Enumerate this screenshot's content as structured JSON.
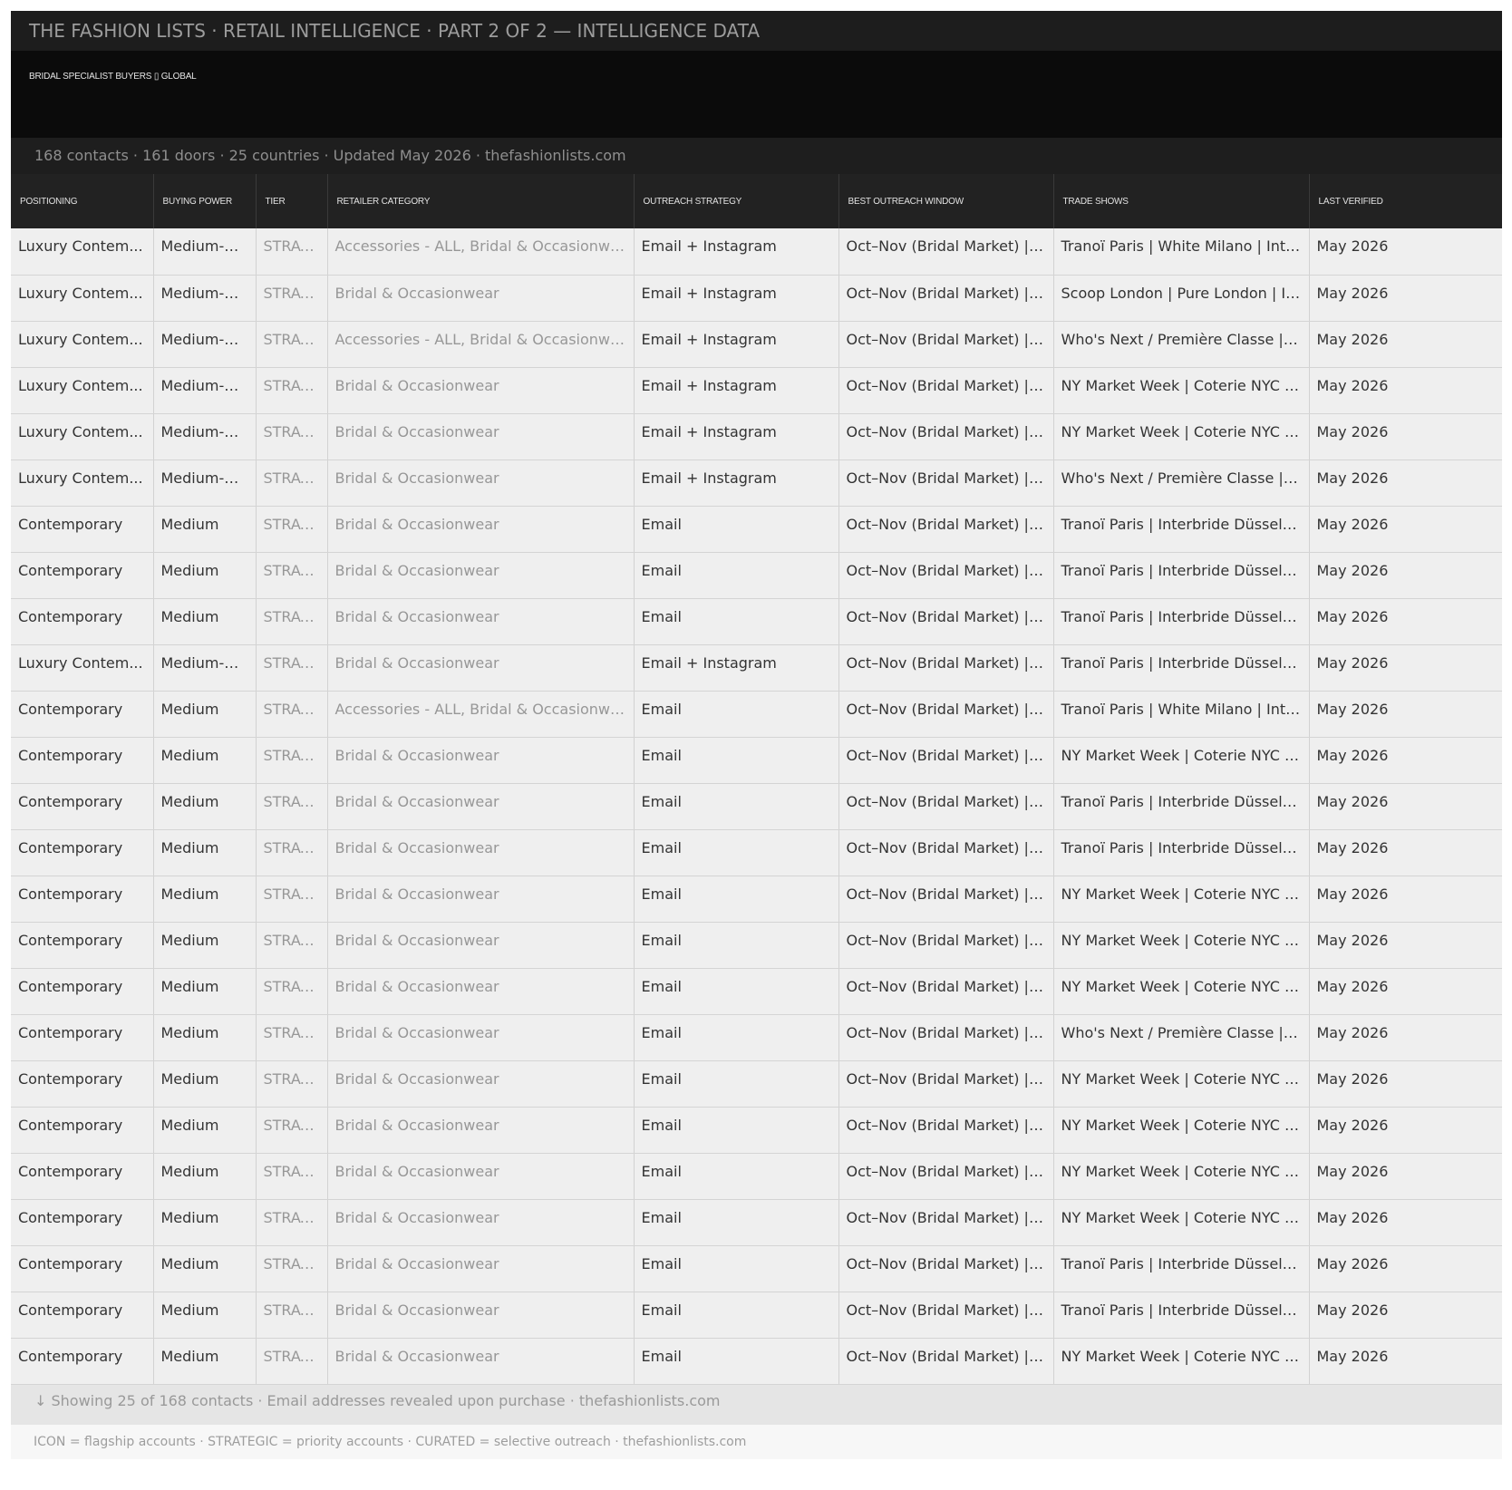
{
  "header": {
    "title": "THE FASHION LISTS  ·  RETAIL INTELLIGENCE  ·  PART 2 OF 2 — INTELLIGENCE DATA",
    "subtitle": "BRIDAL SPECIALIST BUYERS ▯ GLOBAL",
    "stats": "168 contacts  ·  161 doors  ·  25 countries  ·  Updated May 2026  ·  thefashionlists.com"
  },
  "table": {
    "columns": [
      "POSITIONING",
      "BUYING POWER",
      "TIER",
      "RETAILER CATEGORY",
      "OUTREACH STRATEGY",
      "BEST OUTREACH WINDOW",
      "TRADE SHOWS",
      "LAST VERIFIED"
    ],
    "rows": [
      [
        "Luxury Contem...",
        "Medium-Hi...",
        "STRAT...",
        "Accessories - ALL, Bridal & Occasionwear...",
        "Email + Instagram",
        "Oct–Nov (Bridal Market) | A...",
        "Tranoï Paris | White Milano | Inter...",
        "May 2026"
      ],
      [
        "Luxury Contem...",
        "Medium-Hi...",
        "STRAT...",
        "Bridal & Occasionwear",
        "Email + Instagram",
        "Oct–Nov (Bridal Market) | A...",
        "Scoop London | Pure London | Int...",
        "May 2026"
      ],
      [
        "Luxury Contem...",
        "Medium-Hi...",
        "STRAT...",
        "Accessories - ALL, Bridal & Occasionwear...",
        "Email + Instagram",
        "Oct–Nov (Bridal Market) | A...",
        "Who's Next / Première Classe | C...",
        "May 2026"
      ],
      [
        "Luxury Contem...",
        "Medium-Hi...",
        "STRAT...",
        "Bridal & Occasionwear",
        "Email + Instagram",
        "Oct–Nov (Bridal Market) | A...",
        "NY Market Week | Coterie NYC | I...",
        "May 2026"
      ],
      [
        "Luxury Contem...",
        "Medium-Hi...",
        "STRAT...",
        "Bridal & Occasionwear",
        "Email + Instagram",
        "Oct–Nov (Bridal Market) | A...",
        "NY Market Week | Coterie NYC | I...",
        "May 2026"
      ],
      [
        "Luxury Contem...",
        "Medium-Hi...",
        "STRAT...",
        "Bridal & Occasionwear",
        "Email + Instagram",
        "Oct–Nov (Bridal Market) | A...",
        "Who's Next / Première Classe | C...",
        "May 2026"
      ],
      [
        "Contemporary",
        "Medium",
        "STRAT...",
        "Bridal & Occasionwear",
        "Email",
        "Oct–Nov (Bridal Market) | A...",
        "Tranoï Paris | Interbride Düsseldo...",
        "May 2026"
      ],
      [
        "Contemporary",
        "Medium",
        "STRAT...",
        "Bridal & Occasionwear",
        "Email",
        "Oct–Nov (Bridal Market) | A...",
        "Tranoï Paris | Interbride Düsseldo...",
        "May 2026"
      ],
      [
        "Contemporary",
        "Medium",
        "STRAT...",
        "Bridal & Occasionwear",
        "Email",
        "Oct–Nov (Bridal Market) | A...",
        "Tranoï Paris | Interbride Düsseldo...",
        "May 2026"
      ],
      [
        "Luxury Contem...",
        "Medium-Hi...",
        "STRAT...",
        "Bridal & Occasionwear",
        "Email + Instagram",
        "Oct–Nov (Bridal Market) | A...",
        "Tranoï Paris | Interbride Düsseldo...",
        "May 2026"
      ],
      [
        "Contemporary",
        "Medium",
        "STRAT...",
        "Accessories - ALL, Bridal & Occasionwear...",
        "Email",
        "Oct–Nov (Bridal Market) | A...",
        "Tranoï Paris | White Milano | Inter...",
        "May 2026"
      ],
      [
        "Contemporary",
        "Medium",
        "STRAT...",
        "Bridal & Occasionwear",
        "Email",
        "Oct–Nov (Bridal Market) | A...",
        "NY Market Week | Coterie NYC | I...",
        "May 2026"
      ],
      [
        "Contemporary",
        "Medium",
        "STRAT...",
        "Bridal & Occasionwear",
        "Email",
        "Oct–Nov (Bridal Market) | A...",
        "Tranoï Paris | Interbride Düsseldo...",
        "May 2026"
      ],
      [
        "Contemporary",
        "Medium",
        "STRAT...",
        "Bridal & Occasionwear",
        "Email",
        "Oct–Nov (Bridal Market) | A...",
        "Tranoï Paris | Interbride Düsseldo...",
        "May 2026"
      ],
      [
        "Contemporary",
        "Medium",
        "STRAT...",
        "Bridal & Occasionwear",
        "Email",
        "Oct–Nov (Bridal Market) | A...",
        "NY Market Week | Coterie NYC | I...",
        "May 2026"
      ],
      [
        "Contemporary",
        "Medium",
        "STRAT...",
        "Bridal & Occasionwear",
        "Email",
        "Oct–Nov (Bridal Market) | A...",
        "NY Market Week | Coterie NYC | I...",
        "May 2026"
      ],
      [
        "Contemporary",
        "Medium",
        "STRAT...",
        "Bridal & Occasionwear",
        "Email",
        "Oct–Nov (Bridal Market) | A...",
        "NY Market Week | Coterie NYC | I...",
        "May 2026"
      ],
      [
        "Contemporary",
        "Medium",
        "STRAT...",
        "Bridal & Occasionwear",
        "Email",
        "Oct–Nov (Bridal Market) | A...",
        "Who's Next / Première Classe | C...",
        "May 2026"
      ],
      [
        "Contemporary",
        "Medium",
        "STRAT...",
        "Bridal & Occasionwear",
        "Email",
        "Oct–Nov (Bridal Market) | A...",
        "NY Market Week | Coterie NYC | I...",
        "May 2026"
      ],
      [
        "Contemporary",
        "Medium",
        "STRAT...",
        "Bridal & Occasionwear",
        "Email",
        "Oct–Nov (Bridal Market) | A...",
        "NY Market Week | Coterie NYC | I...",
        "May 2026"
      ],
      [
        "Contemporary",
        "Medium",
        "STRAT...",
        "Bridal & Occasionwear",
        "Email",
        "Oct–Nov (Bridal Market) | A...",
        "NY Market Week | Coterie NYC | I...",
        "May 2026"
      ],
      [
        "Contemporary",
        "Medium",
        "STRAT...",
        "Bridal & Occasionwear",
        "Email",
        "Oct–Nov (Bridal Market) | A...",
        "NY Market Week | Coterie NYC | I...",
        "May 2026"
      ],
      [
        "Contemporary",
        "Medium",
        "STRAT...",
        "Bridal & Occasionwear",
        "Email",
        "Oct–Nov (Bridal Market) | A...",
        "Tranoï Paris | Interbride Düsseldo...",
        "May 2026"
      ],
      [
        "Contemporary",
        "Medium",
        "STRAT...",
        "Bridal & Occasionwear",
        "Email",
        "Oct–Nov (Bridal Market) | A...",
        "Tranoï Paris | Interbride Düsseldo...",
        "May 2026"
      ],
      [
        "Contemporary",
        "Medium",
        "STRAT...",
        "Bridal & Occasionwear",
        "Email",
        "Oct–Nov (Bridal Market) | A...",
        "NY Market Week | Coterie NYC | I...",
        "May 2026"
      ]
    ]
  },
  "footer": {
    "showing": "↓  Showing 25 of 168 contacts  ·  Email addresses revealed upon purchase  ·  thefashionlists.com",
    "legend": "ICON = flagship accounts  ·  STRATEGIC = priority accounts  ·  CURATED = selective outreach  ·  thefashionlists.com"
  },
  "colors": {
    "header_bg": "#1d1d1d",
    "banner_bg": "#0b0b0b",
    "row_bg": "#efefef",
    "muted_text": "#979797"
  }
}
